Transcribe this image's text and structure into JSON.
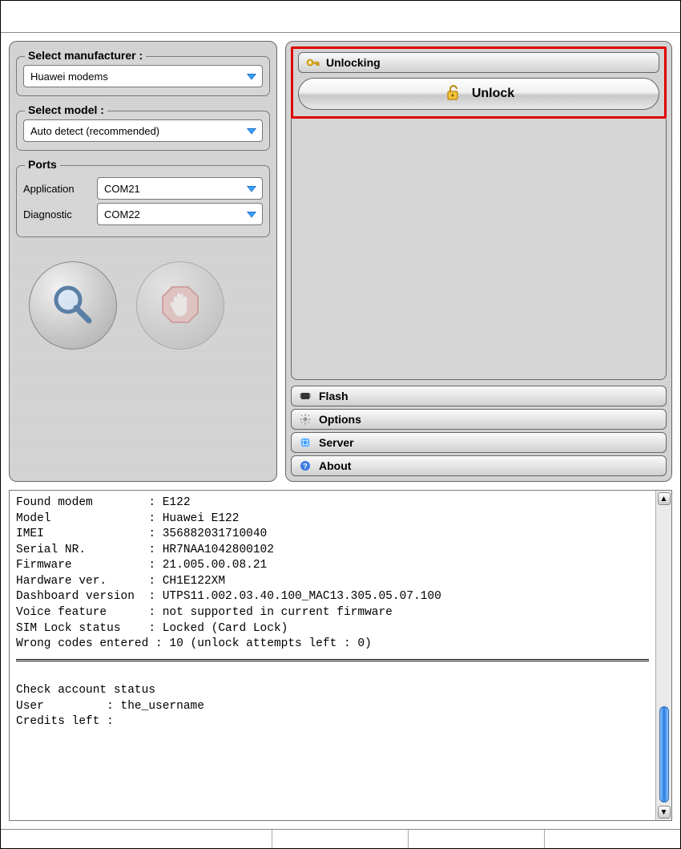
{
  "left": {
    "manufacturer": {
      "title": "Select manufacturer :",
      "value": "Huawei modems"
    },
    "model": {
      "title": "Select model :",
      "value": "Auto detect (recommended)"
    },
    "ports": {
      "title": "Ports",
      "application_label": "Application",
      "application_value": "COM21",
      "diagnostic_label": "Diagnostic",
      "diagnostic_value": "COM22"
    }
  },
  "right": {
    "unlocking": {
      "header": "Unlocking",
      "button": "Unlock"
    },
    "sections": {
      "flash": "Flash",
      "options": "Options",
      "server": "Server",
      "about": "About"
    }
  },
  "log": {
    "lines": [
      "Found modem        : E122",
      "Model              : Huawei E122",
      "IMEI               : 356882031710040",
      "Serial NR.         : HR7NAA1042800102",
      "Firmware           : 21.005.00.08.21",
      "Hardware ver.      : CH1E122XM",
      "Dashboard version  : UTPS11.002.03.40.100_MAC13.305.05.07.100",
      "Voice feature      : not supported in current firmware",
      "SIM Lock status    : Locked (Card Lock)",
      "Wrong codes entered : 10 (unlock attempts left : 0)"
    ],
    "account": [
      "Check account status",
      "User         : the_username",
      "Credits left :"
    ]
  }
}
